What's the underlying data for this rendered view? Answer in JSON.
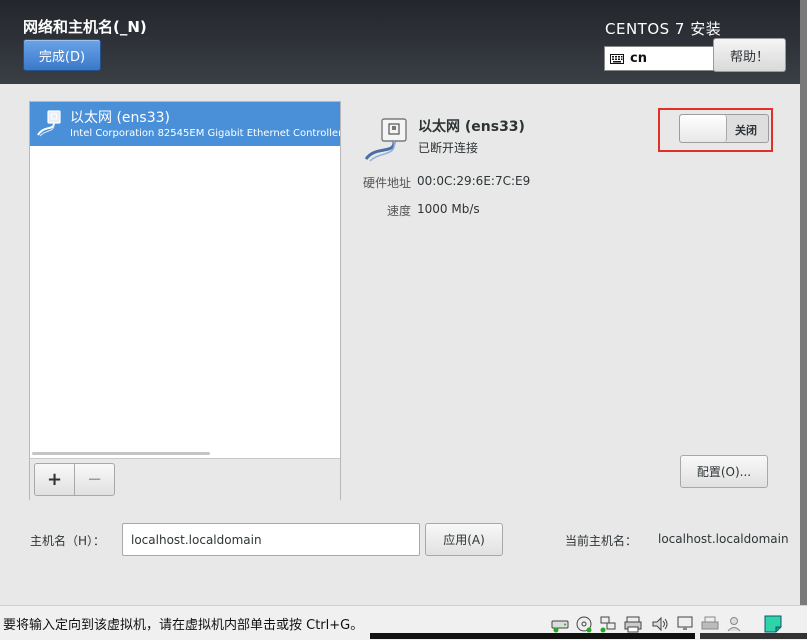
{
  "header": {
    "title": "网络和主机名(_N)",
    "done_label": "完成(D)",
    "product": "CENTOS 7 安装",
    "keyboard_layout": "cn",
    "help_label": "帮助！"
  },
  "devices": [
    {
      "name": "以太网 (ens33)",
      "description": "Intel Corporation 82545EM Gigabit Ethernet Controller (",
      "selected": true
    }
  ],
  "device_toolbar": {
    "add_label": "+",
    "remove_label": "−"
  },
  "detail": {
    "name": "以太网 (ens33)",
    "status": "已断开连接",
    "hw_label": "硬件地址",
    "hw_value": "00:0C:29:6E:7C:E9",
    "speed_label": "速度",
    "speed_value": "1000 Mb/s",
    "switch_label": "关闭",
    "switch_on": false,
    "config_label": "配置(O)..."
  },
  "hostname": {
    "label": "主机名（H）：",
    "value": "localhost.localdomain",
    "apply_label": "应用(A)",
    "current_label": "当前主机名：",
    "current_value": "localhost.localdomain"
  },
  "statusbar": {
    "message": "要将输入定向到该虚拟机，请在虚拟机内部单击或按 Ctrl+G。"
  },
  "colors": {
    "accent": "#4a90d9",
    "highlight": "#e0302a",
    "header_bg": "#2b2f35"
  }
}
